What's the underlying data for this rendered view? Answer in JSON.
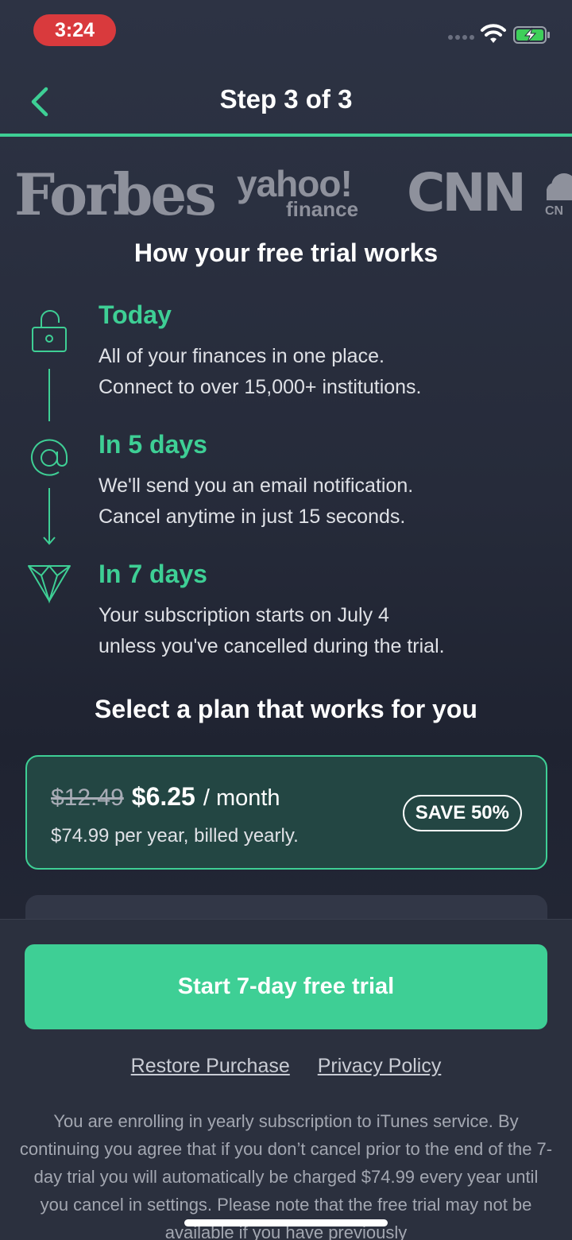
{
  "status_bar": {
    "time": "3:24",
    "signal_icon": "cellular-dots-icon",
    "wifi_icon": "wifi-icon",
    "battery_icon": "battery-charging-icon"
  },
  "nav": {
    "back_icon": "chevron-left-icon",
    "title": "Step 3 of 3"
  },
  "logos": {
    "forbes": "Forbes",
    "yahoo": "yahoo!",
    "yahoo_sub": "finance",
    "cnn": "CNN"
  },
  "trial": {
    "title": "How your free trial works",
    "steps": [
      {
        "icon": "unlock-icon",
        "heading": "Today",
        "line1": "All of your finances in one place.",
        "line2": "Connect to over 15,000+ institutions."
      },
      {
        "icon": "at-sign-icon",
        "heading": "In 5 days",
        "line1": "We'll send you an email notification.",
        "line2": "Cancel anytime in just 15 seconds."
      },
      {
        "icon": "diamond-icon",
        "heading": "In 7 days",
        "line1": "Your subscription starts on July 4",
        "line2": "unless you've cancelled during the trial."
      }
    ]
  },
  "plans": {
    "title": "Select a plan that works for you",
    "selected": {
      "old_price": "$12.49",
      "new_price": "$6.25",
      "period": "/ month",
      "subtext": "$74.99 per year, billed yearly.",
      "badge": "SAVE 50%"
    }
  },
  "footer": {
    "cta": "Start 7-day free trial",
    "restore": "Restore Purchase",
    "privacy": "Privacy Policy",
    "disclaimer": "You are enrolling in yearly subscription to iTunes service. By continuing you agree that if you don’t cancel prior to the end of the 7-day trial you will automatically be charged $74.99 every year until you cancel in settings. Please note that the free trial may not be available if you have previously"
  },
  "colors": {
    "accent": "#3ecf95",
    "background": "#262b3a",
    "card_selected": "#234643",
    "time_pill": "#d93a3d"
  }
}
